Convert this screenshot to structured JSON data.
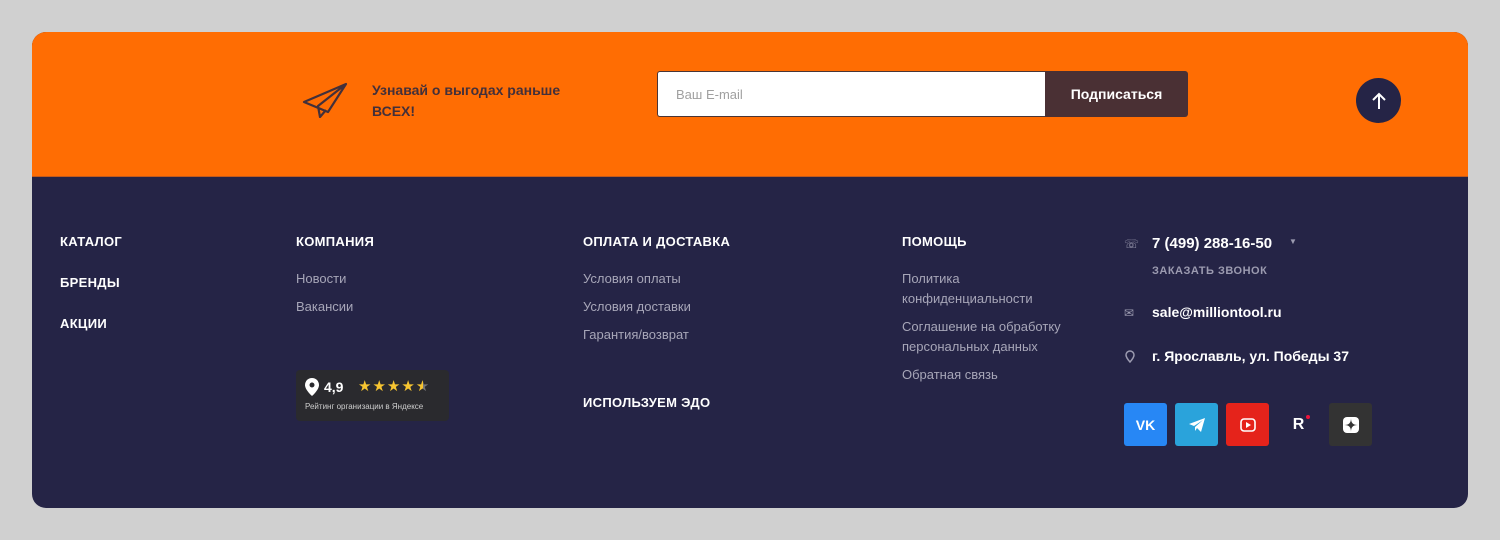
{
  "subscribe": {
    "text": "Узнавай о выгодах раньше ВСЕХ!",
    "email_placeholder": "Ваш E-mail",
    "button": "Подписаться"
  },
  "nav": {
    "catalog": "КАТАЛОГ",
    "brands": "БРЕНДЫ",
    "promo": "АКЦИИ",
    "company": {
      "title": "КОМПАНИЯ",
      "links": [
        "Новости",
        "Вакансии"
      ]
    },
    "payment": {
      "title": "ОПЛАТА И ДОСТАВКА",
      "links": [
        "Условия оплаты",
        "Условия доставки",
        "Гарантия/возврат"
      ],
      "edo": "ИСПОЛЬЗУЕМ ЭДО"
    },
    "help": {
      "title": "ПОМОЩЬ",
      "links": [
        "Политика конфиденциальности",
        "Соглашение на обработку персональных данных",
        "Обратная связь"
      ]
    }
  },
  "rating": {
    "value": "4,9",
    "stars": 4.5,
    "caption": "Рейтинг организации в Яндексе"
  },
  "contacts": {
    "phone": "7 (499) 288-16-50",
    "callback": "ЗАКАЗАТЬ ЗВОНОК",
    "email": "sale@milliontool.ru",
    "address": "г. Ярославль, ул. Победы 37"
  },
  "social": {
    "vk": "VK",
    "rutube": "R"
  },
  "colors": {
    "orange": "#ff6d03",
    "navy": "#252446",
    "vk": "#2787f5",
    "telegram": "#2aa3db",
    "youtube": "#e5231b",
    "dzen": "#333333"
  }
}
